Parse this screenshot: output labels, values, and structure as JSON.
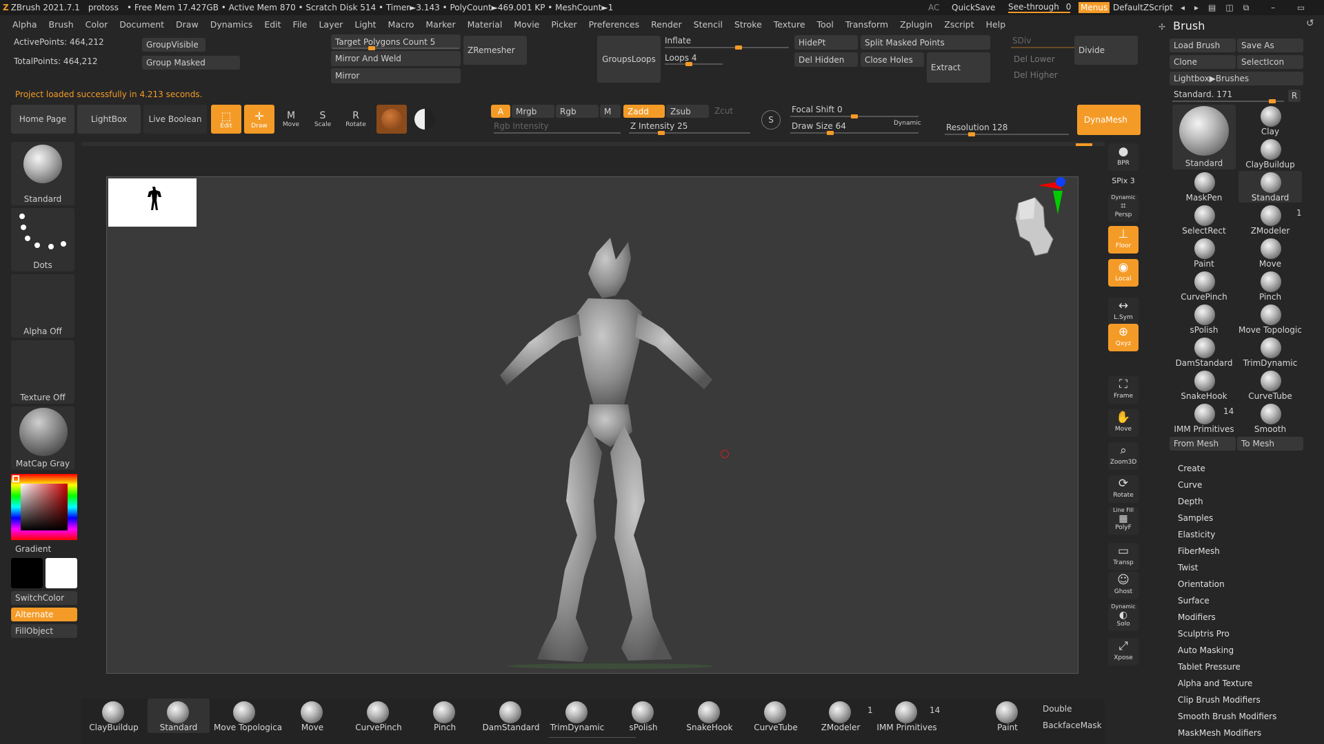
{
  "titlebar": {
    "app": "ZBrush 2021.7.1",
    "project": "protoss",
    "stats": "• Free Mem 17.427GB • Active Mem 870 • Scratch Disk 514 • Timer►3.143 • PolyCount►469.001 KP • MeshCount►1",
    "ac": "AC",
    "quicksave": "QuickSave",
    "see_through": "See-through",
    "see_through_value": "0",
    "menus": "Menus",
    "default_zscript": "DefaultZScript"
  },
  "menubar": [
    "Alpha",
    "Brush",
    "Color",
    "Document",
    "Draw",
    "Dynamics",
    "Edit",
    "File",
    "Layer",
    "Light",
    "Macro",
    "Marker",
    "Material",
    "Movie",
    "Picker",
    "Preferences",
    "Render",
    "Stencil",
    "Stroke",
    "Texture",
    "Tool",
    "Transform",
    "Zplugin",
    "Zscript",
    "Help"
  ],
  "info": {
    "active_points": "ActivePoints: 464,212",
    "total_points": "TotalPoints: 464,212",
    "status": "Project loaded successfully in 4.213 seconds."
  },
  "top_tools": {
    "group_visible": "GroupVisible",
    "group_masked": "Group Masked",
    "target_polygons": "Target Polygons Count 5",
    "target_polygons_value": 0.3,
    "mirror_and_weld": "Mirror And Weld",
    "mirror": "Mirror",
    "zremesher": "ZRemesher",
    "groups_loops": "GroupsLoops",
    "inflate": "Inflate",
    "inflate_value": 0.6,
    "loops": "Loops 4",
    "loops_value": 0.4,
    "hide_pt": "HidePt",
    "del_hidden": "Del Hidden",
    "split_masked": "Split Masked Points",
    "close_holes": "Close Holes",
    "extract": "Extract",
    "sdiv": "SDiv",
    "del_lower": "Del Lower",
    "del_higher": "Del Higher",
    "divide": "Divide"
  },
  "shelf": {
    "home_page": "Home Page",
    "lightbox": "LightBox",
    "live_boolean": "Live Boolean",
    "edit": "Edit",
    "draw": "Draw",
    "move": "Move",
    "scale": "Scale",
    "rotate": "Rotate",
    "a": "A",
    "mrgb": "Mrgb",
    "rgb": "Rgb",
    "m": "M",
    "zadd": "Zadd",
    "zsub": "Zsub",
    "zcut": "Zcut",
    "rgb_intensity": "Rgb Intensity",
    "z_intensity": "Z Intensity 25",
    "z_intensity_value": 0.25,
    "focal_shift": "Focal Shift 0",
    "focal_shift_value": 0.5,
    "draw_size": "Draw Size 64",
    "draw_size_value": 0.3,
    "dynamic": "Dynamic",
    "resolution": "Resolution 128",
    "resolution_value": 0.2,
    "dynamesh": "DynaMesh"
  },
  "left_panel": {
    "brush": "Standard",
    "stroke": "Dots",
    "alpha": "Alpha Off",
    "texture": "Texture Off",
    "material": "MatCap Gray",
    "gradient": "Gradient",
    "switch_color": "SwitchColor",
    "alternate": "Alternate",
    "fill_object": "FillObject"
  },
  "right_shelf": [
    {
      "label": "BPR",
      "icon": "bpr-icon"
    },
    {
      "label": "SPix 3",
      "icon": "spix-slider"
    },
    {
      "label": "Persp",
      "icon": "persp-icon",
      "top": "Dynamic"
    },
    {
      "label": "Floor",
      "icon": "floor-icon"
    },
    {
      "label": "Local",
      "icon": "local-icon"
    },
    {
      "label": "L.Sym",
      "icon": "lsym-icon"
    },
    {
      "label": "Qxyz",
      "icon": "xyz-icon"
    },
    {
      "label": "Frame",
      "icon": "frame-icon"
    },
    {
      "label": "Move",
      "icon": "move-icon"
    },
    {
      "label": "Zoom3D",
      "icon": "zoom-icon"
    },
    {
      "label": "Rotate",
      "icon": "rotate-icon"
    },
    {
      "label": "PolyF",
      "icon": "polyf-icon",
      "top": "Line Fill"
    },
    {
      "label": "Transp",
      "icon": "transp-icon"
    },
    {
      "label": "Ghost",
      "icon": "ghost-icon"
    },
    {
      "label": "Solo",
      "icon": "solo-icon",
      "top": "Dynamic"
    },
    {
      "label": "Xpose",
      "icon": "xpose-icon"
    }
  ],
  "brush_palette": {
    "title": "Brush",
    "load_brush": "Load Brush",
    "save_as": "Save As",
    "clone": "Clone",
    "select_icon": "SelectIcon",
    "lightbox_brushes": "Lightbox▶Brushes",
    "standard_value": "Standard. 171",
    "r": "R",
    "big": "Standard",
    "tiles": [
      "Clay",
      "ClayBuildup",
      "MaskPen",
      "Standard",
      "SelectRect",
      "ZModeler",
      "Paint",
      "Move",
      "CurvePinch",
      "Pinch",
      "sPolish",
      "Move Topologica",
      "DamStandard",
      "TrimDynamic",
      "SnakeHook",
      "CurveTube",
      "IMM Primitives",
      "Smooth"
    ],
    "zmodeler_count": "1",
    "imm_count": "14",
    "from_mesh": "From Mesh",
    "to_mesh": "To Mesh",
    "subpalettes": [
      "Create",
      "Curve",
      "Depth",
      "Samples",
      "Elasticity",
      "FiberMesh",
      "Twist",
      "Orientation",
      "Surface",
      "Modifiers",
      "Sculptris Pro",
      "Auto Masking",
      "Tablet Pressure",
      "Alpha and Texture",
      "Clip Brush Modifiers",
      "Smooth Brush Modifiers",
      "MaskMesh Modifiers"
    ]
  },
  "bottom_shelf": {
    "items": [
      "ClayBuildup",
      "Standard",
      "Move Topologica",
      "Move",
      "CurvePinch",
      "Pinch",
      "DamStandard",
      "TrimDynamic",
      "sPolish",
      "SnakeHook",
      "CurveTube",
      "ZModeler",
      "IMM Primitives",
      "Paint"
    ],
    "zmodeler_count": "1",
    "imm_count": "14",
    "double": "Double",
    "backface_mask": "BackfaceMask"
  }
}
